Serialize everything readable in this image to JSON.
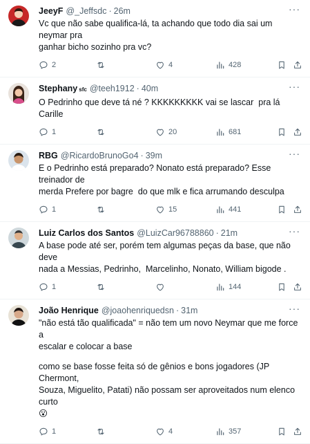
{
  "tweets": [
    {
      "name": "JeeyF",
      "badge": "",
      "handle": "@_Jeffsdc",
      "time": "26m",
      "lines": [
        "Vc que não sabe qualifica-lá, ta achando que todo dia sai um neymar pra",
        "ganhar bicho sozinho pra vc?"
      ],
      "replies": "2",
      "retweets": "",
      "likes": "4",
      "views": "428"
    },
    {
      "name": "Stephany",
      "badge": "sfc",
      "handle": "@teeh1912",
      "time": "40m",
      "lines": [
        "O Pedrinho que deve tá né ? KKKKKKKKK vai se lascar  pra lá Carille"
      ],
      "replies": "1",
      "retweets": "",
      "likes": "20",
      "views": "681"
    },
    {
      "name": "RBG",
      "badge": "",
      "handle": "@RicardoBrunoGo4",
      "time": "39m",
      "lines": [
        "E o Pedrinho está preparado? Nonato está preparado? Esse treinador de",
        "merda Prefere por bagre  do que mlk e fica arrumando desculpa"
      ],
      "replies": "1",
      "retweets": "",
      "likes": "15",
      "views": "441"
    },
    {
      "name": "Luiz Carlos dos Santos",
      "badge": "",
      "handle": "@LuizCar96788860",
      "time": "21m",
      "lines": [
        "A base pode até ser, porém tem algumas peças da base, que não deve",
        "nada a Messias, Pedrinho,  Marcelinho, Nonato, William bigode ."
      ],
      "replies": "1",
      "retweets": "",
      "likes": "",
      "views": "144"
    },
    {
      "name": "João Henrique",
      "badge": "",
      "handle": "@joaohenriquedsn",
      "time": "31m",
      "lines": [
        "\"não está tão qualificada\" = não tem um novo Neymar que me force a",
        "escalar e colocar a base",
        "",
        "como se base fosse feita só de gênios e bons jogadores (JP Chermont,",
        "Souza, Miguelito, Patati) não possam ser aproveitados num elenco curto",
        "😮"
      ],
      "replies": "1",
      "retweets": "",
      "likes": "4",
      "views": "357"
    }
  ],
  "ui": {
    "more_label": "···",
    "separator": "·"
  },
  "colors": {
    "text_primary": "#0f1419",
    "text_secondary": "#536471",
    "divider": "#eff3f4"
  },
  "icons": [
    "reply-icon",
    "retweet-icon",
    "like-icon",
    "views-icon",
    "bookmark-icon",
    "share-icon",
    "more-icon"
  ]
}
